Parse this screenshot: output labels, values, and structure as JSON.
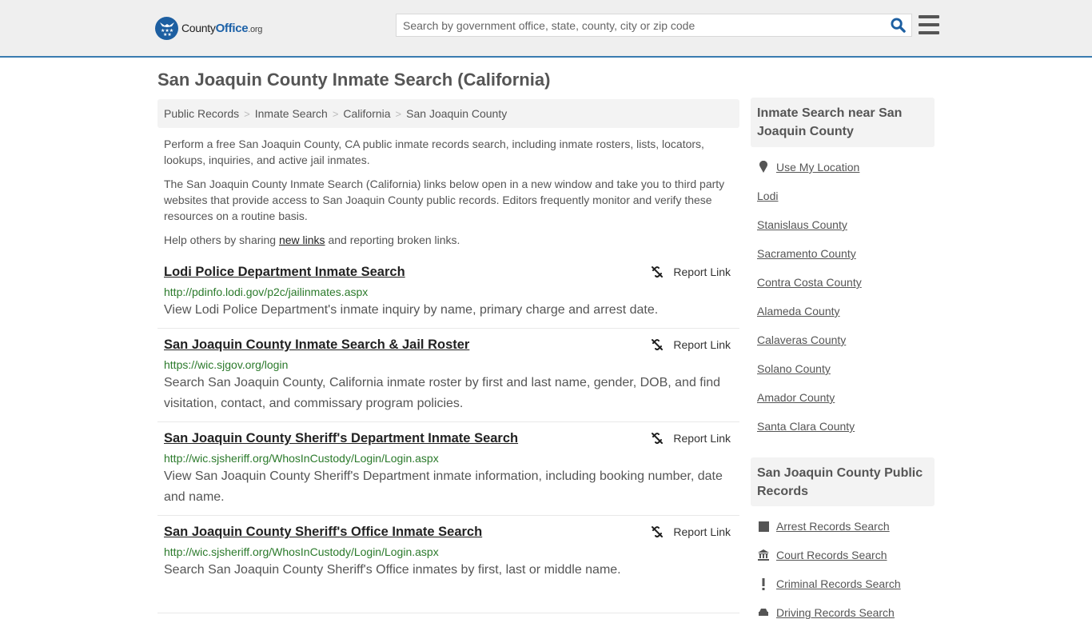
{
  "header": {
    "logo": {
      "county": "County",
      "office": "Office",
      "tld": ".org"
    },
    "search": {
      "placeholder": "Search by government office, state, county, city or zip code",
      "value": ""
    },
    "colors": {
      "accent": "#3a7cb0",
      "brand": "#1d62a8",
      "header_bg": "#efefef"
    }
  },
  "main": {
    "title": "San Joaquin County Inmate Search (California)",
    "breadcrumb": [
      "Public Records",
      "Inmate Search",
      "California",
      "San Joaquin County"
    ],
    "intro": {
      "p1": "Perform a free San Joaquin County, CA public inmate records search, including inmate rosters, lists, locators, lookups, inquiries, and active jail inmates.",
      "p2": "The San Joaquin County Inmate Search (California) links below open in a new window and take you to third party websites that provide access to San Joaquin County public records. Editors frequently monitor and verify these resources on a routine basis.",
      "p3_before": "Help others by sharing ",
      "p3_link": "new links",
      "p3_after": " and reporting broken links."
    },
    "report_label": "Report Link",
    "results": [
      {
        "title": "Lodi Police Department Inmate Search",
        "url": "http://pdinfo.lodi.gov/p2c/jailinmates.aspx",
        "description": "View Lodi Police Department's inmate inquiry by name, primary charge and arrest date."
      },
      {
        "title": "San Joaquin County Inmate Search & Jail Roster",
        "url": "https://wic.sjgov.org/login",
        "description": "Search San Joaquin County, California inmate roster by first and last name, gender, DOB, and find visitation, contact, and commissary program policies."
      },
      {
        "title": "San Joaquin County Sheriff's Department Inmate Search",
        "url": "http://wic.sjsheriff.org/WhosInCustody/Login/Login.aspx",
        "description": "View San Joaquin County Sheriff's Department inmate information, including booking number, date and name."
      },
      {
        "title": "San Joaquin County Sheriff's Office Inmate Search",
        "url": "http://wic.sjsheriff.org/WhosInCustody/Login/Login.aspx",
        "description": "Search San Joaquin County Sheriff's Office inmates by first, last or middle name."
      }
    ]
  },
  "sidebar": {
    "nearby": {
      "heading": "Inmate Search near San Joaquin County",
      "use_location": "Use My Location",
      "items": [
        "Lodi",
        "Stanislaus County",
        "Sacramento County",
        "Contra Costa County",
        "Alameda County",
        "Calaveras County",
        "Solano County",
        "Amador County",
        "Santa Clara County"
      ]
    },
    "public_records": {
      "heading": "San Joaquin County Public Records",
      "items": [
        {
          "label": "Arrest Records Search",
          "icon": "square-icon"
        },
        {
          "label": "Court Records Search",
          "icon": "courthouse-icon"
        },
        {
          "label": "Criminal Records Search",
          "icon": "exclamation-icon"
        },
        {
          "label": "Driving Records Search",
          "icon": "car-icon"
        }
      ]
    }
  }
}
